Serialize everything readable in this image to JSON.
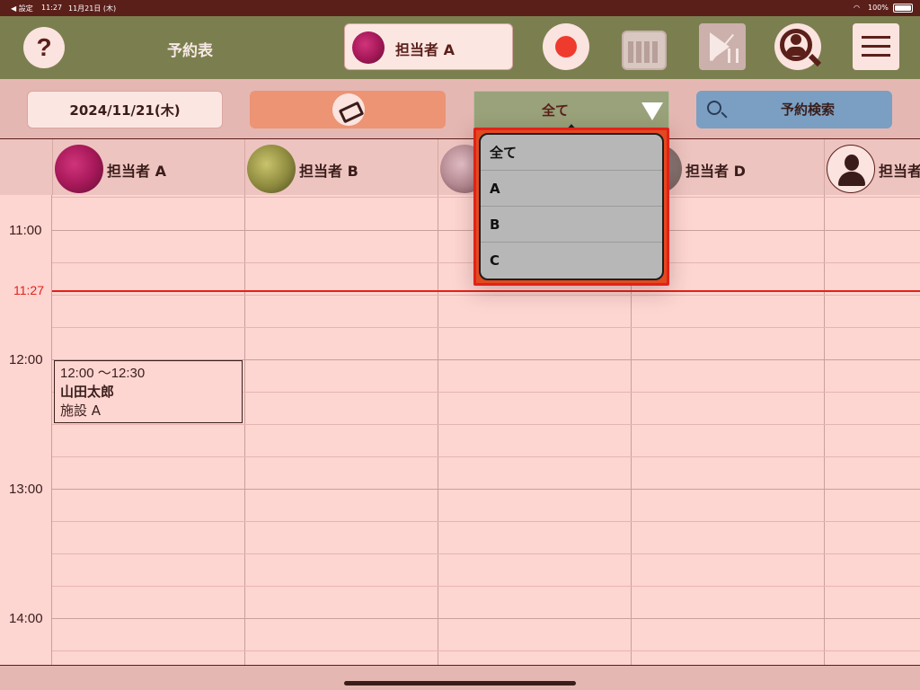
{
  "status_bar": {
    "back_label": "◀ 設定",
    "time": "11:27",
    "date": "11月21日 (木)",
    "wifi": "wifi",
    "battery": "100%"
  },
  "header": {
    "help_label": "?",
    "title": "予約表",
    "staff_selected": "担当者 A"
  },
  "toolbar": {
    "date": "2024/11/21(木)",
    "filter_label": "全て",
    "search_label": "予約検索"
  },
  "dropdown": {
    "items": [
      "全て",
      "A",
      "B",
      "C"
    ]
  },
  "staff_columns": [
    {
      "name": "担当者 A"
    },
    {
      "name": "担当者 B"
    },
    {
      "name": ""
    },
    {
      "name": "担当者 D"
    },
    {
      "name": "担当者"
    }
  ],
  "time_labels": [
    "11:00",
    "12:00",
    "13:00",
    "14:00"
  ],
  "now": {
    "label": "11:27",
    "color": "#e0221a"
  },
  "booking": {
    "time": "12:00 ～12:30",
    "name": "山田太郎",
    "place": "施設 A"
  },
  "colors": {
    "header": "#7b7f4f",
    "background": "#fdd5d1",
    "accent": "#e0221a",
    "filter_button": "#99a27a",
    "search_button": "#7a9fc3",
    "bed_button": "#ec9474"
  }
}
